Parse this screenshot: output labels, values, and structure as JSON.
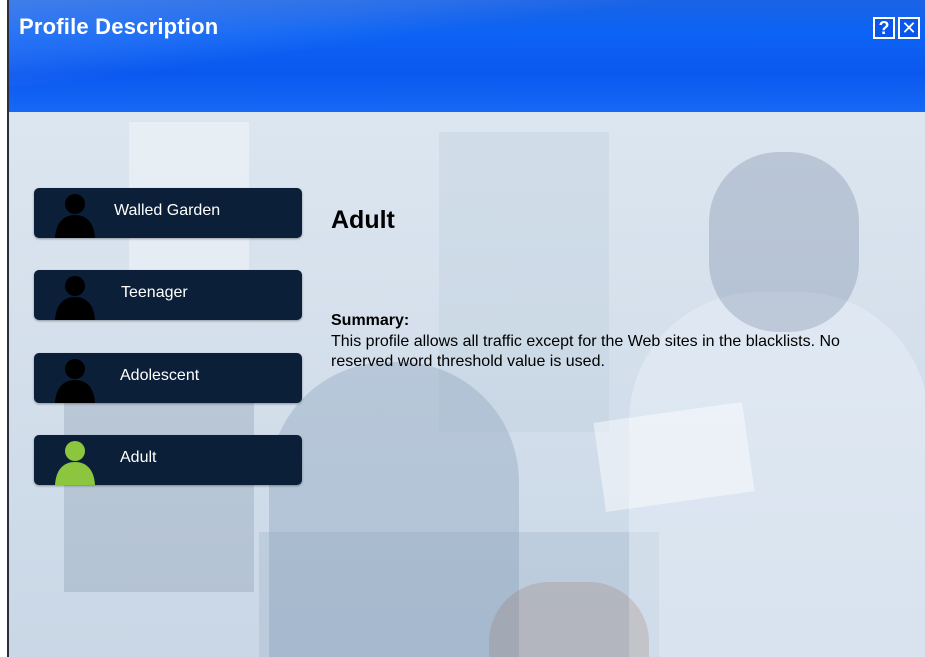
{
  "window": {
    "title": "Profile Description",
    "help_label": "?",
    "close_label": "✕",
    "accent_color": "#0c63f4"
  },
  "profiles": [
    {
      "label": "Walled Garden",
      "icon": "person-icon",
      "selected": false,
      "icon_color": "#000000"
    },
    {
      "label": "Teenager",
      "icon": "person-icon",
      "selected": false,
      "icon_color": "#000000"
    },
    {
      "label": "Adolescent",
      "icon": "person-icon",
      "selected": false,
      "icon_color": "#000000"
    },
    {
      "label": "Adult",
      "icon": "person-icon",
      "selected": true,
      "icon_color": "#8cc63f"
    }
  ],
  "detail": {
    "heading": "Adult",
    "summary_label": "Summary:",
    "summary_text": "This profile allows all traffic except for the Web sites in the blacklists. No reserved word threshold value is used."
  }
}
